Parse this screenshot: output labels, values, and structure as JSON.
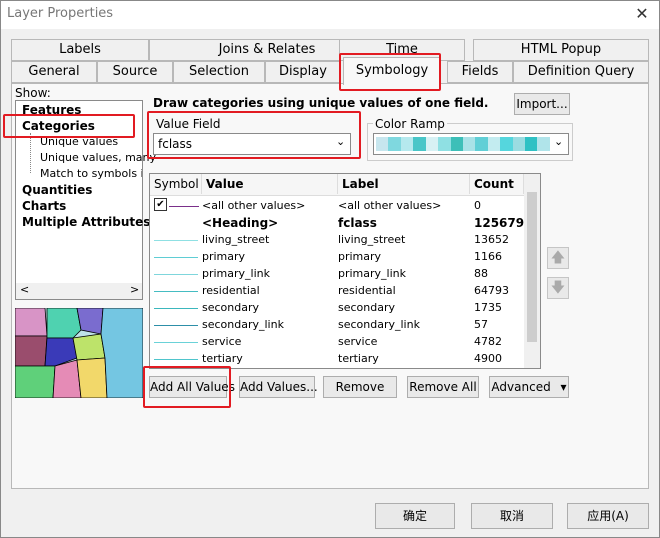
{
  "window": {
    "title": "Layer Properties",
    "close_glyph": "✕"
  },
  "tabs_back": [
    "Labels",
    "Joins & Relates",
    "Time",
    "HTML Popup"
  ],
  "tabs_front": [
    "General",
    "Source",
    "Selection",
    "Display",
    "Symbology",
    "Fields",
    "Definition Query"
  ],
  "show": {
    "label": "Show:",
    "items": [
      "Features",
      "Categories",
      "Unique values",
      "Unique values, many",
      "Match to symbols in a",
      "Quantities",
      "Charts",
      "Multiple Attributes"
    ],
    "scroll_left": "<",
    "scroll_right": ">"
  },
  "description": "Draw categories using unique values of one field.",
  "import_label": "Import...",
  "value_field": {
    "label": "Value Field",
    "value": "fclass"
  },
  "color_ramp": {
    "label": "Color Ramp",
    "swatches": [
      "#c7e6ee",
      "#7fd8df",
      "#b5e9ee",
      "#49c6c8",
      "#d7f1f4",
      "#8fe0e3",
      "#3dbfb8",
      "#a9e2e7",
      "#61cfd6",
      "#c3ecf0",
      "#55d6dd",
      "#9adce1",
      "#2fc1c4",
      "#b0e4ea"
    ]
  },
  "table": {
    "headers": [
      "Symbol",
      "Value",
      "Label",
      "Count"
    ],
    "rows": [
      {
        "value": "<all other values>",
        "label": "<all other values>",
        "count": "0",
        "color": "#7a2f8a",
        "checked": true
      },
      {
        "value": "<Heading>",
        "label": "fclass",
        "count": "125679",
        "color": "",
        "bold": true
      },
      {
        "value": "living_street",
        "label": "living_street",
        "count": "13652",
        "color": "#8fe0e3"
      },
      {
        "value": "primary",
        "label": "primary",
        "count": "1166",
        "color": "#5fcdd4"
      },
      {
        "value": "primary_link",
        "label": "primary_link",
        "count": "88",
        "color": "#7fd6dc"
      },
      {
        "value": "residential",
        "label": "residential",
        "count": "64793",
        "color": "#45bcc2"
      },
      {
        "value": "secondary",
        "label": "secondary",
        "count": "1735",
        "color": "#3bb7bd"
      },
      {
        "value": "secondary_link",
        "label": "secondary_link",
        "count": "57",
        "color": "#2d8fa8"
      },
      {
        "value": "service",
        "label": "service",
        "count": "4782",
        "color": "#6ad2d8"
      },
      {
        "value": "tertiary",
        "label": "tertiary",
        "count": "4900",
        "color": "#4fc5cc"
      }
    ]
  },
  "move_up": "🡅",
  "move_down": "🡇",
  "buttons": {
    "add_all": "Add All Values",
    "add_values": "Add Values...",
    "remove": "Remove",
    "remove_all": "Remove All",
    "advanced": "Advanced",
    "advanced_arrow": "▾"
  },
  "footer": {
    "ok": "确定",
    "cancel": "取消",
    "apply": "应用(A)"
  },
  "preview_colors": [
    "#d894c6",
    "#9a4d6d",
    "#4fd2b0",
    "#5fd07a",
    "#7a6ccf",
    "#bde36a",
    "#e58bb6",
    "#3a3ab8",
    "#f2d86a",
    "#74c6e2"
  ]
}
